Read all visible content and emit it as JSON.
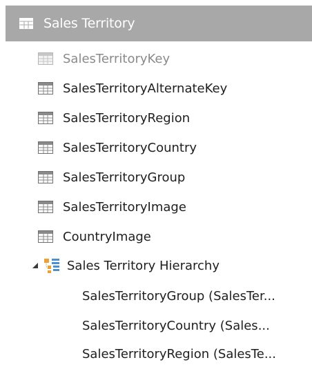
{
  "table": {
    "title": "Sales Territory",
    "columns": [
      {
        "label": "SalesTerritoryKey",
        "hidden": true
      },
      {
        "label": "SalesTerritoryAlternateKey",
        "hidden": false
      },
      {
        "label": "SalesTerritoryRegion",
        "hidden": false
      },
      {
        "label": "SalesTerritoryCountry",
        "hidden": false
      },
      {
        "label": "SalesTerritoryGroup",
        "hidden": false
      },
      {
        "label": "SalesTerritoryImage",
        "hidden": false
      },
      {
        "label": "CountryImage",
        "hidden": false
      }
    ],
    "hierarchy": {
      "label": "Sales Territory Hierarchy",
      "expanded": true,
      "levels": [
        "SalesTerritoryGroup (SalesTer...",
        "SalesTerritoryCountry (Sales...",
        "SalesTerritoryRegion (SalesTe..."
      ]
    }
  },
  "colors": {
    "header_bg": "#a8a8a8",
    "header_text": "#ffffff",
    "text": "#1e1e1e",
    "hidden_text": "#8a8a8a",
    "hierarchy_icon_orange": "#f0a030",
    "hierarchy_icon_blue": "#4a90d0"
  },
  "icons": {
    "header": "table-icon",
    "column": "column-icon",
    "hierarchy": "hierarchy-icon",
    "expander": "expanded-triangle-icon"
  }
}
